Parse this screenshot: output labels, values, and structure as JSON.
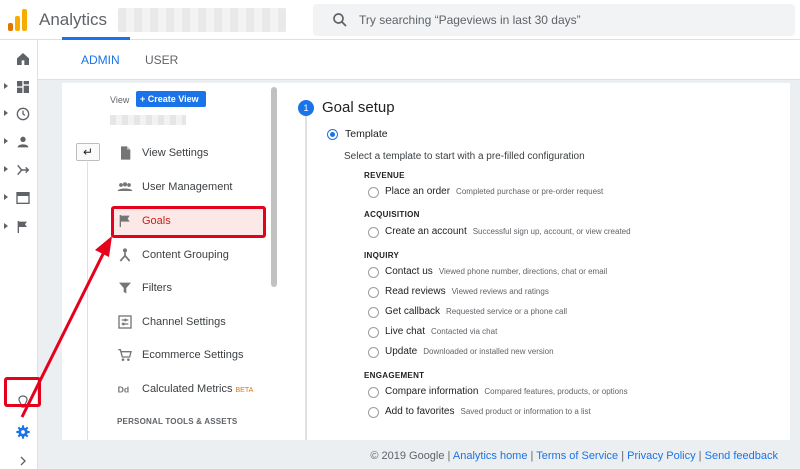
{
  "app": {
    "title": "Analytics"
  },
  "search": {
    "placeholder": "Try searching “Pageviews in last 30 days”"
  },
  "tabs": [
    {
      "label": "ADMIN",
      "active": true
    },
    {
      "label": "USER",
      "active": false
    }
  ],
  "view": {
    "label": "View",
    "create_button": "+ Create View"
  },
  "menu": [
    {
      "label": "View Settings",
      "icon": "document-icon"
    },
    {
      "label": "User Management",
      "icon": "users-icon"
    },
    {
      "label": "Goals",
      "icon": "flag-icon",
      "selected": true
    },
    {
      "label": "Content Grouping",
      "icon": "grouping-icon"
    },
    {
      "label": "Filters",
      "icon": "filter-icon"
    },
    {
      "label": "Channel Settings",
      "icon": "channel-icon"
    },
    {
      "label": "Ecommerce Settings",
      "icon": "cart-icon"
    },
    {
      "label": "Calculated Metrics",
      "badge": "BETA",
      "icon": "dd-icon"
    }
  ],
  "section_personal": "PERSONAL TOOLS & ASSETS",
  "goal_setup": {
    "step": "1",
    "title": "Goal setup",
    "template_label": "Template",
    "instruction": "Select a template to start with a pre-filled configuration",
    "groups": [
      {
        "title": "REVENUE",
        "options": [
          {
            "name": "Place an order",
            "desc": "Completed purchase or pre-order request"
          }
        ]
      },
      {
        "title": "ACQUISITION",
        "options": [
          {
            "name": "Create an account",
            "desc": "Successful sign up, account, or view created"
          }
        ]
      },
      {
        "title": "INQUIRY",
        "options": [
          {
            "name": "Contact us",
            "desc": "Viewed phone number, directions, chat or email"
          },
          {
            "name": "Read reviews",
            "desc": "Viewed reviews and ratings"
          },
          {
            "name": "Get callback",
            "desc": "Requested service or a phone call"
          },
          {
            "name": "Live chat",
            "desc": "Contacted via chat"
          },
          {
            "name": "Update",
            "desc": "Downloaded or installed new version"
          }
        ]
      },
      {
        "title": "ENGAGEMENT",
        "options": [
          {
            "name": "Compare information",
            "desc": "Compared features, products, or options"
          },
          {
            "name": "Add to favorites",
            "desc": "Saved product or information to a list"
          }
        ]
      }
    ]
  },
  "footer": {
    "copyright": "© 2019 Google",
    "links": [
      "Analytics home",
      "Terms of Service",
      "Privacy Policy",
      "Send feedback"
    ]
  },
  "colors": {
    "accent": "#1a73e8",
    "highlight": "#e5001c"
  }
}
